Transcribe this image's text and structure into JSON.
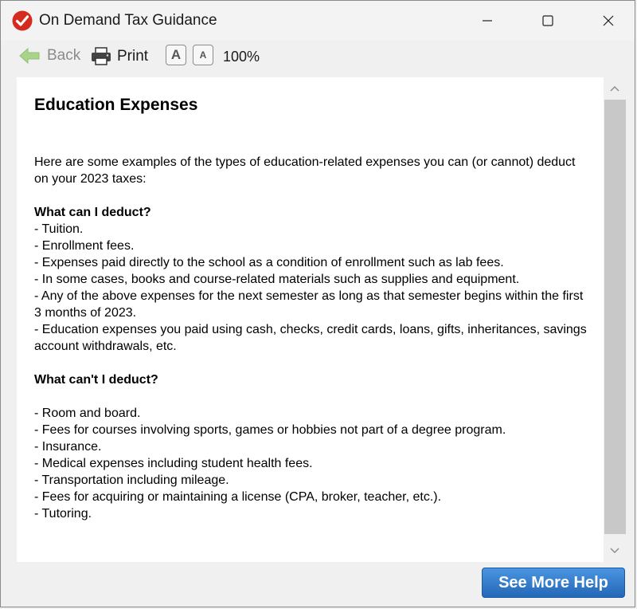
{
  "window": {
    "title": "On Demand Tax Guidance",
    "controls": [
      "minimize",
      "maximize",
      "close"
    ],
    "app_icon": "checkmark-icon",
    "app_icon_color": "#d52b1e"
  },
  "toolbar": {
    "back_label": "Back",
    "print_label": "Print",
    "increase_font_label": "A",
    "decrease_font_label": "A",
    "zoom_level": "100%"
  },
  "article": {
    "title": "Education Expenses",
    "intro": "Here are some examples of the types of education-related expenses you can (or cannot) deduct on your 2023 taxes:",
    "can_deduct_heading": "What can I deduct?",
    "can_deduct_items": [
      " - Tuition.",
      " - Enrollment fees.",
      " - Expenses paid directly to the school as a condition of enrollment such as lab fees.",
      " - In some cases, books and course-related materials such as supplies and equipment.",
      " - Any of the above expenses for the next semester as long as that semester begins within the first 3 months of 2023.",
      " - Education expenses you paid using cash, checks, credit cards, loans, gifts, inheritances, savings account withdrawals, etc."
    ],
    "cannot_deduct_heading": "What can't I deduct?",
    "cannot_deduct_items": [
      " - Room and board.",
      " - Fees for courses involving sports, games or hobbies not part of a degree program.",
      " - Insurance.",
      " - Medical expenses including student health fees.",
      " - Transportation including mileage.",
      " - Fees for acquiring or maintaining a license (CPA, broker, teacher, etc.).",
      " - Tutoring."
    ]
  },
  "footer": {
    "help_button_label": "See More Help",
    "help_button_color": "#2f7bd0"
  }
}
